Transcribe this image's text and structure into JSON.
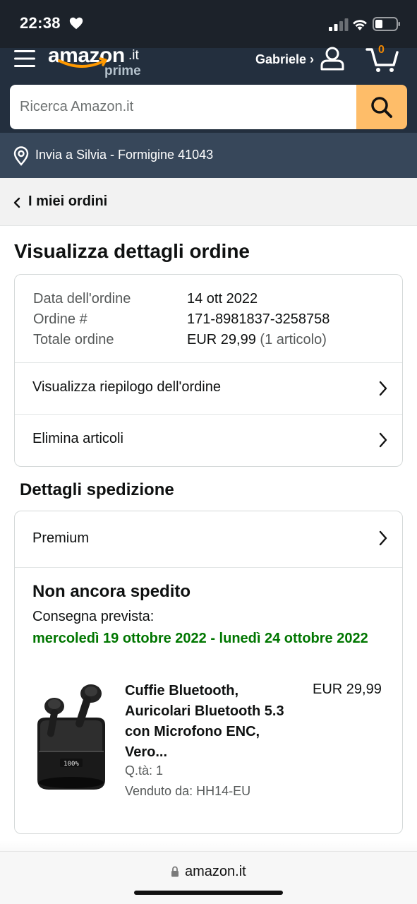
{
  "status_bar": {
    "time": "22:38"
  },
  "header": {
    "logo_text": "amazon",
    "logo_tld": ".it",
    "logo_prime": "prime",
    "account_label": "Gabriele ›",
    "cart_count": "0",
    "search_placeholder": "Ricerca Amazon.it",
    "deliver_to": "Invia a Silvia - Formigine 41043"
  },
  "breadcrumb": {
    "label": "I miei ordini"
  },
  "page_title": "Visualizza dettagli ordine",
  "order_info": {
    "rows": [
      {
        "label": "Data dell'ordine",
        "value": "14 ott 2022",
        "extra": ""
      },
      {
        "label": "Ordine #",
        "value": "171-8981837-3258758",
        "extra": ""
      },
      {
        "label": "Totale ordine",
        "value": "EUR 29,99",
        "extra": "(1 articolo)"
      }
    ],
    "links": [
      {
        "label": "Visualizza riepilogo dell'ordine"
      },
      {
        "label": "Elimina articoli"
      }
    ]
  },
  "shipping": {
    "section_title": "Dettagli spedizione",
    "method": "Premium",
    "status": "Non ancora spedito",
    "eta_label": "Consegna prevista:",
    "eta_dates": "mercoledì 19 ottobre 2022 - lunedì 24 ottobre 2022",
    "item": {
      "title": "Cuffie Bluetooth, Auricolari Bluetooth 5.3 con Microfono ENC, Vero...",
      "price": "EUR 29,99",
      "qty": "Q.tà: 1",
      "seller": "Venduto da: HH14-EU",
      "image_display": "100%"
    }
  },
  "url_bar": {
    "domain": "amazon.it"
  },
  "colors": {
    "header": "#232f3e",
    "deliver_bar": "#37475a",
    "search_button": "#febd69",
    "eta_green": "#007600",
    "cart_count": "#f08804"
  }
}
